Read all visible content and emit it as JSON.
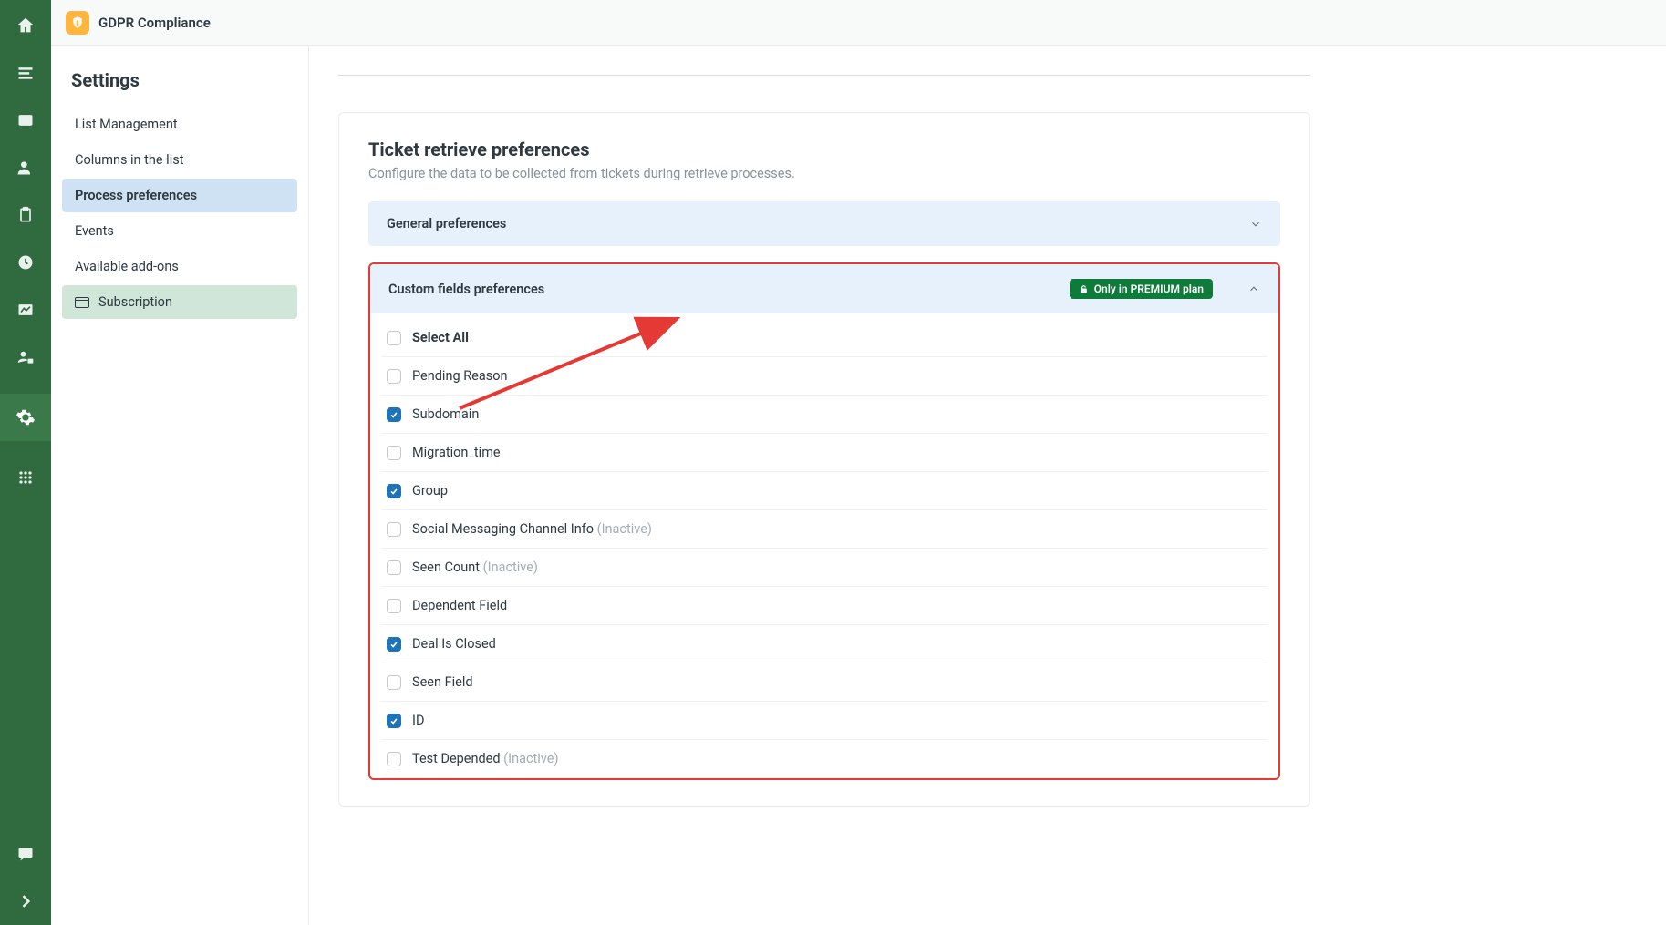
{
  "header": {
    "app_title": "GDPR Compliance"
  },
  "settings": {
    "heading": "Settings",
    "items": [
      {
        "label": "List Management",
        "active": false
      },
      {
        "label": "Columns in the list",
        "active": false
      },
      {
        "label": "Process preferences",
        "active": true
      },
      {
        "label": "Events",
        "active": false
      },
      {
        "label": "Available add-ons",
        "active": false
      },
      {
        "label": "Subscription",
        "active": false,
        "icon": "card",
        "highlight": true
      }
    ]
  },
  "content": {
    "title": "Ticket retrieve preferences",
    "subtitle": "Configure the data to be collected from tickets during retrieve processes.",
    "general_acc": "General preferences",
    "custom_acc": "Custom fields preferences",
    "premium_badge": "Only in PREMIUM plan",
    "select_all": "Select All",
    "fields": [
      {
        "label": "Pending Reason",
        "checked": false
      },
      {
        "label": "Subdomain",
        "checked": true
      },
      {
        "label": "Migration_time",
        "checked": false
      },
      {
        "label": "Group",
        "checked": true
      },
      {
        "label": "Social Messaging Channel Info",
        "checked": false,
        "inactive": true
      },
      {
        "label": "Seen Count",
        "checked": false,
        "inactive": true
      },
      {
        "label": "Dependent Field",
        "checked": false
      },
      {
        "label": "Deal Is Closed",
        "checked": true
      },
      {
        "label": "Seen Field",
        "checked": false
      },
      {
        "label": "ID",
        "checked": true
      },
      {
        "label": "Test Depended",
        "checked": false,
        "inactive": true
      }
    ],
    "inactive_text": "(Inactive)"
  }
}
